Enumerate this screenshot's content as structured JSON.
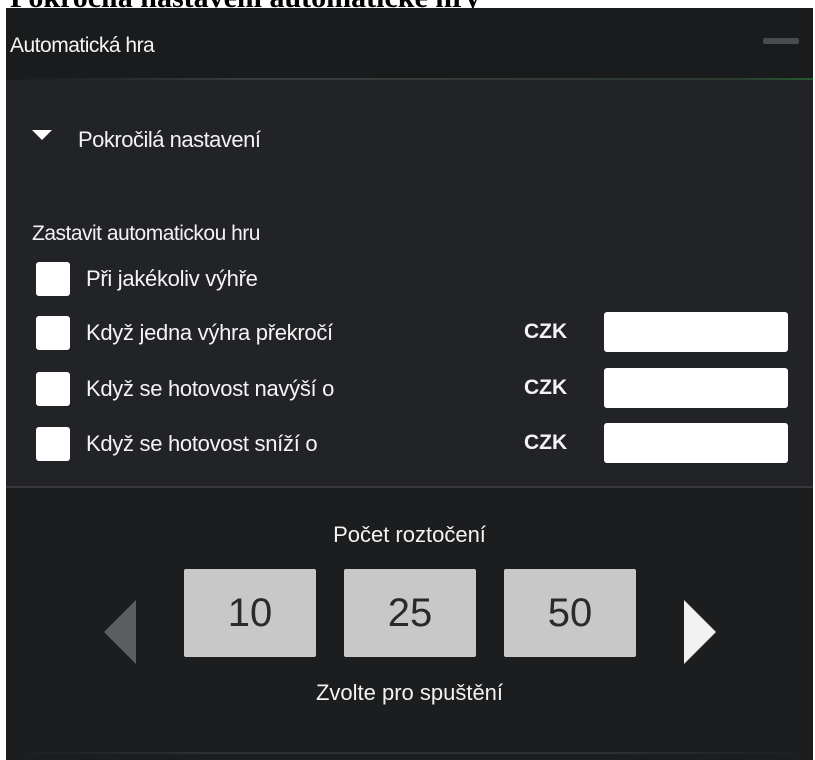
{
  "document": {
    "title": "Pokročilá nastavení automatické hry"
  },
  "panel": {
    "title": "Automatická hra",
    "icons": {
      "minimize": "minimize-icon"
    }
  },
  "advanced": {
    "label": "Pokročilá nastavení",
    "expanded": true,
    "icon": "triangle-down-icon"
  },
  "stop": {
    "heading": "Zastavit automatickou hru",
    "options": [
      {
        "label": "Při jakékoliv výhře",
        "checked": false
      },
      {
        "label": "Když jedna výhra překročí",
        "checked": false,
        "currency": "CZK",
        "value": ""
      },
      {
        "label": "Když se hotovost navýší o",
        "checked": false,
        "currency": "CZK",
        "value": ""
      },
      {
        "label": "Když se hotovost sníží o",
        "checked": false,
        "currency": "CZK",
        "value": ""
      }
    ]
  },
  "spins": {
    "title": "Počet roztočení",
    "options": [
      "10",
      "25",
      "50"
    ],
    "hint": "Zvolte pro spuštění",
    "prev_enabled": false,
    "next_enabled": true
  },
  "colors": {
    "panel_bg": "#222326",
    "header_bg": "#1a1b1d",
    "bottom_bg": "#1c1d1f",
    "button_bg": "#c8c8c8",
    "text": "#f2f2f2",
    "disabled_arrow": "#5c5d60"
  }
}
